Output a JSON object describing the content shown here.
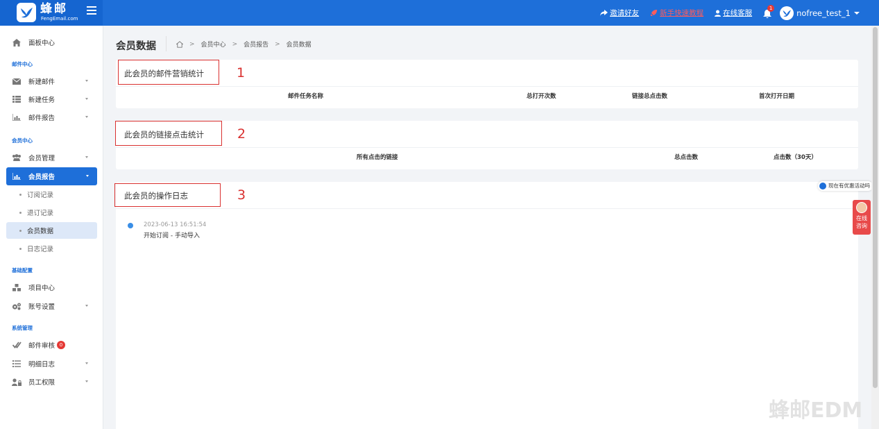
{
  "header": {
    "logo_text": "蜂邮",
    "logo_sub": "FengEmail.com",
    "links": [
      {
        "label": "邀请好友",
        "icon": "share-icon"
      },
      {
        "label": "新手快速教程",
        "icon": "rocket-icon"
      },
      {
        "label": "在线客服",
        "icon": "user-icon"
      }
    ],
    "notification_count": "1",
    "username": "nofree_test_1"
  },
  "sidebar": {
    "dashboard": "面板中心",
    "sections": {
      "mail": "邮件中心",
      "member": "会员中心",
      "basic": "基础配置",
      "system": "系统管理"
    },
    "items": {
      "new_mail": "新建邮件",
      "new_task": "新建任务",
      "mail_report": "邮件报告",
      "member_mgmt": "会员管理",
      "member_report": "会员报告",
      "sub_records": "订阅记录",
      "unsub_records": "退订记录",
      "member_data": "会员数据",
      "log_records": "日志记录",
      "project_center": "项目中心",
      "account_settings": "账号设置",
      "mail_review": "邮件审核",
      "mail_review_badge": "0",
      "detail_log": "明细日志",
      "staff_perms": "员工权限"
    }
  },
  "page": {
    "title": "会员数据",
    "breadcrumb": [
      "会员中心",
      "会员报告",
      "会员数据"
    ]
  },
  "cards": {
    "mail_stats": {
      "title": "此会员的邮件营销统计",
      "marker": "1",
      "columns": [
        "邮件任务名称",
        "总打开次数",
        "链接总点击数",
        "首次打开日期"
      ]
    },
    "link_stats": {
      "title": "此会员的链接点击统计",
      "marker": "2",
      "columns": [
        "所有点击的链接",
        "总点击数",
        "点击数（30天）"
      ]
    },
    "op_log": {
      "title": "此会员的操作日志",
      "marker": "3",
      "entries": [
        {
          "time": "2023-06-13 16:51:54",
          "text": "开始订阅 - 手动导入"
        }
      ]
    }
  },
  "widgets": {
    "promo": "现在有优惠活动吗",
    "consult": [
      "在线",
      "咨询"
    ],
    "watermark": "蜂邮EDM"
  },
  "colors": {
    "primary": "#1e6fd9",
    "highlight": "#d9302f"
  }
}
